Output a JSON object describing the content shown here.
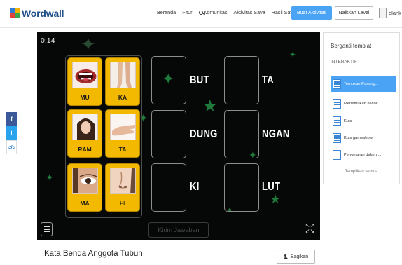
{
  "brand": {
    "name": "Wordwall"
  },
  "nav": {
    "items": [
      "Beranda",
      "Fitur",
      "Komunitas",
      "Aktivitas Saya",
      "Hasil Saya"
    ],
    "create_label": "Buat Aktivitas",
    "upgrade_label": "Naikkan Level",
    "user_name": "dlank"
  },
  "share": {
    "facebook": "f",
    "twitter": "t",
    "embed": "</>"
  },
  "game": {
    "timer": "0:14",
    "tiles": [
      "MU",
      "KA",
      "RAM",
      "TA",
      "MA",
      "HI"
    ],
    "syllables": [
      "BUT",
      "TA",
      "DUNG",
      "NGAN",
      "KI",
      "LUT"
    ],
    "submit_label": "Kirim Jawaban",
    "fullscreen_icon": "fullscreen-icon",
    "menu_icon": "menu-icon"
  },
  "panel": {
    "title": "Berganti templat",
    "section": "INTERAKTIF",
    "templates": [
      "Temukan Pasang...",
      "Menemukan kecoc...",
      "Kuis",
      "Kuis gameshow",
      "Pengejaran dalam ..."
    ],
    "show_all": "Tampilkan semua"
  },
  "activity": {
    "title": "Kata Benda Anggota Tubuh",
    "share_label": "Bagikan"
  },
  "colors": {
    "accent": "#4aa3f5",
    "tile": "#f3b900",
    "game_bg": "#050806",
    "star": "#1f7a3c"
  }
}
